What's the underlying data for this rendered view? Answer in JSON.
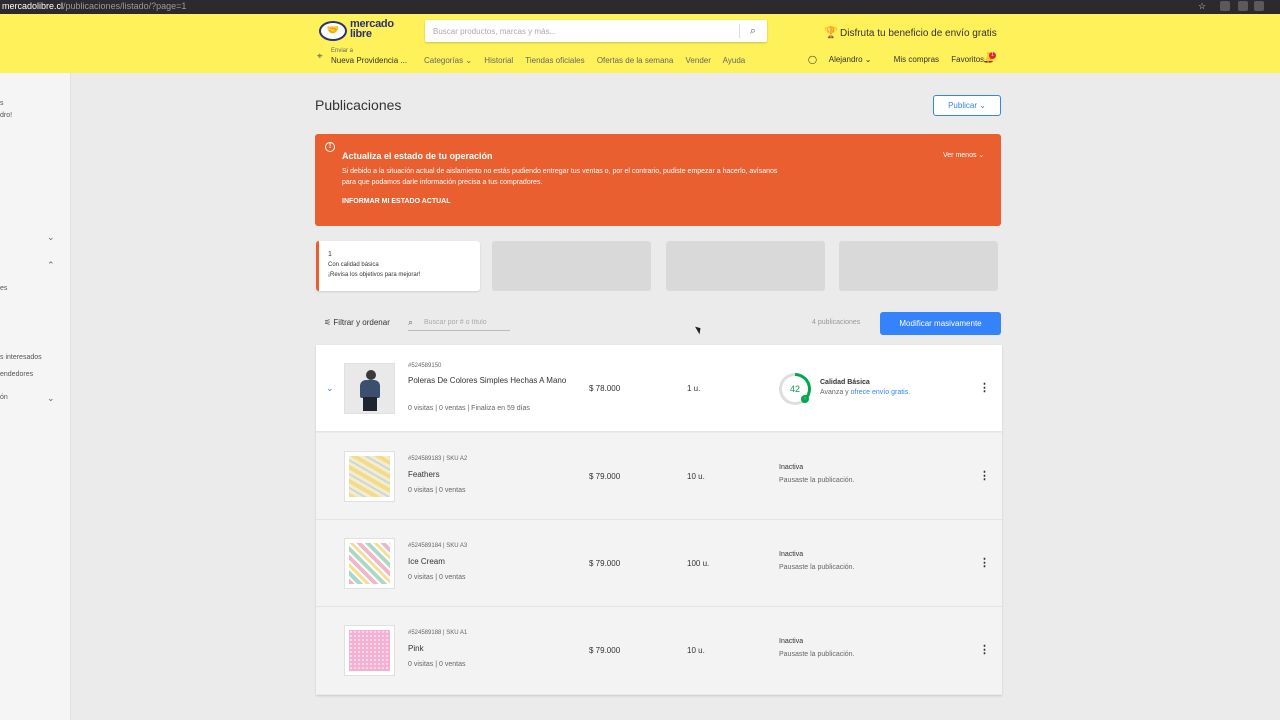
{
  "browser": {
    "host": "mercadolibre.cl",
    "path": "/publicaciones/listado/?page=1"
  },
  "header": {
    "logo_text_1": "mercado",
    "logo_text_2": "libre",
    "search_placeholder": "Buscar productos, marcas y más...",
    "promo": "Disfruta tu beneficio de envío gratis",
    "location_label": "Enviar a",
    "location_value": "Nueva Providencia ...",
    "nav": [
      "Categorías ⌄",
      "Historial",
      "Tiendas oficiales",
      "Ofertas de la semana",
      "Vender",
      "Ayuda"
    ],
    "user": "Alejandro ⌄",
    "purchases": "Mis compras",
    "favorites": "Favoritos ⌄",
    "notif_count": "1"
  },
  "sidebar": {
    "items": [
      "s",
      "dro!",
      "es",
      "s interesados",
      "endedores",
      "ón"
    ]
  },
  "page": {
    "title": "Publicaciones",
    "publish_button": "Publicar ⌄"
  },
  "alert": {
    "icon": "!",
    "title": "Actualiza el estado de tu operación",
    "body": "Si debido a la situación actual de aislamiento no estás pudiendo entregar tus ventas o, por el contrario, pudiste empezar a hacerlo, avísanos para que podamos darle información precisa a tus compradores.",
    "link": "INFORMAR MI ESTADO ACTUAL",
    "toggle": "Ver menos ⌄",
    "color": "#ea5f2f"
  },
  "quality_card": {
    "count": "1",
    "label": "Con calidad básica",
    "hint": "¡Revisa los objetivos para mejorar!"
  },
  "toolbar": {
    "filter_label": "Filtrar y ordenar",
    "search_placeholder": "Buscar por # o título",
    "count": "4 publicaciones",
    "bulk_button": "Modificar masivamente"
  },
  "listings": [
    {
      "id": "#524589150",
      "title": "Poleras De Colores Simples Hechas A Mano",
      "meta": "0 visitas | 0 ventas | Finaliza en 59 días",
      "price": "$ 78.000",
      "stock": "1 u.",
      "quality_score": "42",
      "quality_score_value": 42,
      "quality_title": "Calidad Básica",
      "quality_text": "Avanza y ",
      "quality_link": "ofrece envío gratis."
    },
    {
      "id": "#524589183 | SKU A2",
      "title": "Feathers",
      "meta": "0 visitas | 0 ventas",
      "price": "$ 79.000",
      "stock": "10 u.",
      "status": "Inactiva",
      "status_detail": "Pausaste la publicación."
    },
    {
      "id": "#524589184 | SKU A3",
      "title": "Ice Cream",
      "meta": "0 visitas | 0 ventas",
      "price": "$ 79.000",
      "stock": "100 u.",
      "status": "Inactiva",
      "status_detail": "Pausaste la publicación."
    },
    {
      "id": "#524589188 | SKU A1",
      "title": "Pink",
      "meta": "0 visitas | 0 ventas",
      "price": "$ 79.000",
      "stock": "10 u.",
      "status": "Inactiva",
      "status_detail": "Pausaste la publicación."
    }
  ],
  "icons": {
    "search": "search-icon",
    "pin": "location-pin-icon",
    "user": "user-icon",
    "bell": "bell-icon",
    "filter": "filter-icon",
    "kebab": "kebab-icon",
    "expand": "chevron-down-icon"
  },
  "colors": {
    "header": "#fff159",
    "accent": "#3483fa",
    "success": "#00a650"
  }
}
